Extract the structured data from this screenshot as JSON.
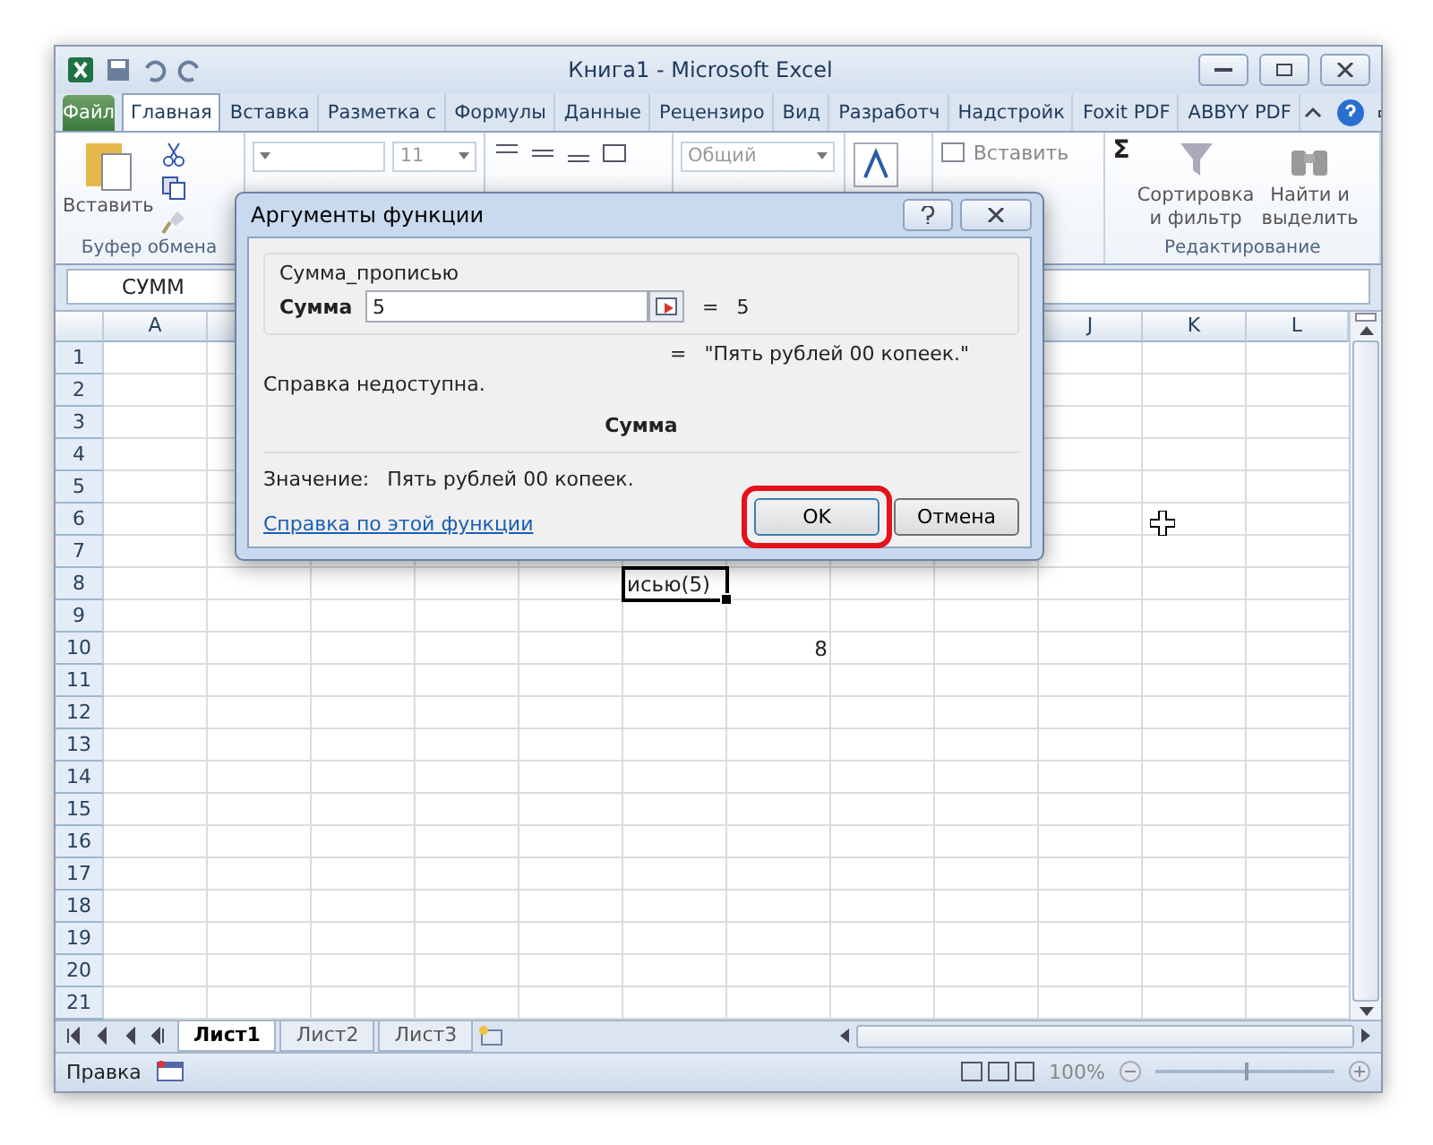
{
  "window": {
    "title": "Книга1  -  Microsoft Excel"
  },
  "tabs": [
    {
      "label": "Файл",
      "kind": "file",
      "selected": false
    },
    {
      "label": "Главная",
      "kind": "tab",
      "selected": true
    },
    {
      "label": "Вставка",
      "kind": "tab",
      "selected": false
    },
    {
      "label": "Разметка с",
      "kind": "tab",
      "selected": false
    },
    {
      "label": "Формулы",
      "kind": "tab",
      "selected": false
    },
    {
      "label": "Данные",
      "kind": "tab",
      "selected": false
    },
    {
      "label": "Рецензиро",
      "kind": "tab",
      "selected": false
    },
    {
      "label": "Вид",
      "kind": "tab",
      "selected": false
    },
    {
      "label": "Разработч",
      "kind": "tab",
      "selected": false
    },
    {
      "label": "Надстройк",
      "kind": "tab",
      "selected": false
    },
    {
      "label": "Foxit PDF",
      "kind": "tab",
      "selected": false
    },
    {
      "label": "ABBYY PDF",
      "kind": "tab",
      "selected": false
    }
  ],
  "ribbon": {
    "paste_label": "Вставить",
    "clipboard_group": "Буфер обмена",
    "font_size": "11",
    "number_format": "Общий",
    "insert_cells": "Вставить",
    "sum_symbol": "Σ",
    "sort_lines": [
      "Сортировка",
      "и фильтр"
    ],
    "find_lines": [
      "Найти и",
      "выделить"
    ],
    "editing_group": "Редактирование"
  },
  "name_box": "СУММ",
  "columns": [
    "A",
    null,
    null,
    null,
    null,
    null,
    null,
    null,
    null,
    "J",
    "K",
    "L"
  ],
  "rows": [
    {
      "header": "1"
    },
    {
      "header": "2"
    },
    {
      "header": "3"
    },
    {
      "header": "4"
    },
    {
      "header": "5"
    },
    {
      "header": "6"
    },
    {
      "header": "7"
    },
    {
      "header": "8",
      "cells": [
        null,
        null,
        null,
        null,
        null,
        {
          "value": "исью(5)",
          "kind": "text",
          "selected": true
        }
      ]
    },
    {
      "header": "9"
    },
    {
      "header": "10",
      "cells": [
        null,
        null,
        null,
        null,
        null,
        null,
        {
          "value": "8",
          "kind": "number",
          "selected": false
        }
      ]
    },
    {
      "header": "11"
    },
    {
      "header": "12"
    },
    {
      "header": "13"
    },
    {
      "header": "14"
    },
    {
      "header": "15"
    },
    {
      "header": "16"
    },
    {
      "header": "17"
    },
    {
      "header": "18"
    },
    {
      "header": "19"
    },
    {
      "header": "20"
    },
    {
      "header": "21"
    }
  ],
  "sheet_tabs": [
    {
      "label": "Лист1",
      "selected": true
    },
    {
      "label": "Лист2",
      "selected": false
    },
    {
      "label": "Лист3",
      "selected": false
    }
  ],
  "status_bar": {
    "mode": "Правка",
    "zoom": "100%",
    "zoom_slider": {
      "level": 0.5
    }
  },
  "dialog": {
    "title": "Аргументы функции",
    "function_name": "Сумма_прописью",
    "argument_label": "Сумма",
    "argument_value": "5",
    "equals": "=",
    "argument_result": "5",
    "formula_equals": "=",
    "formula_result": "\"Пять рублей  00 копеек.\"",
    "help_text": "Справка недоступна.",
    "argument_help_title": "Сумма",
    "value_label": "Значение:",
    "value_text": "Пять рублей  00 копеек.",
    "help_link": "Справка по этой функции",
    "buttons": [
      {
        "label": "OK",
        "highlighted": true
      },
      {
        "label": "Отмена",
        "highlighted": false
      }
    ]
  }
}
